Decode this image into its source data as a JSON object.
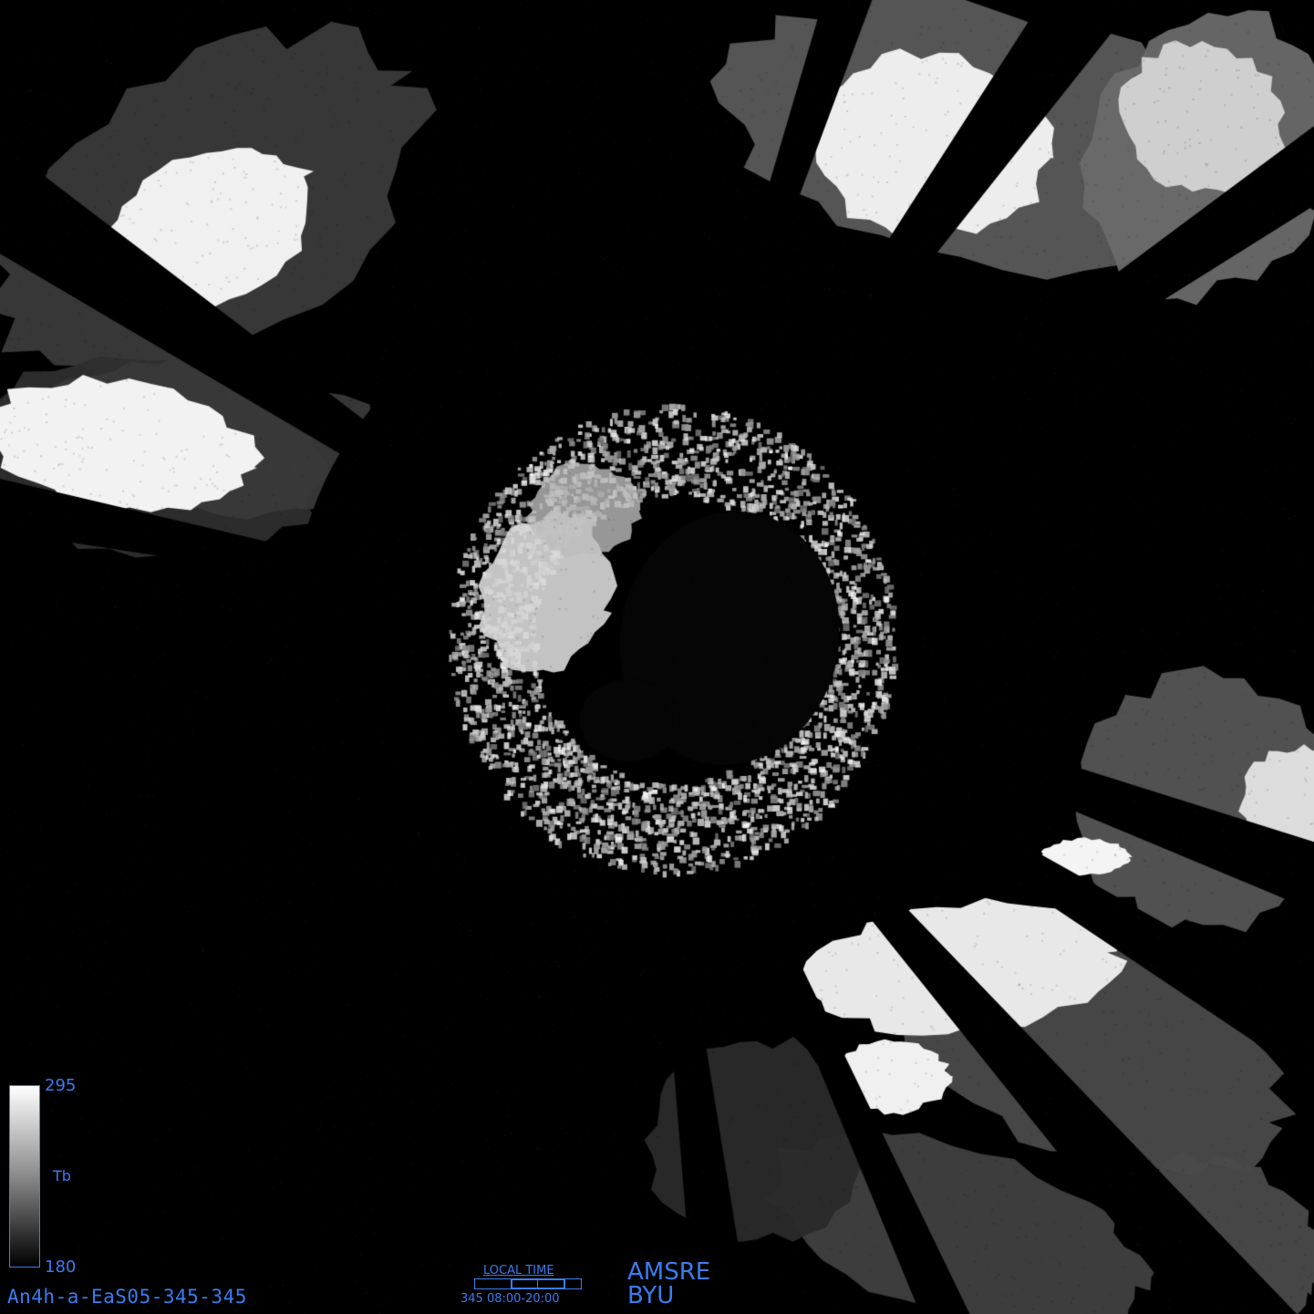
{
  "image": {
    "description_free": true,
    "background_color": "#000000",
    "overlay_color": "#3b7cf0"
  },
  "colorbar": {
    "max": "295",
    "min": "180",
    "label": "Tb"
  },
  "image_id": "An4h-a-EaS05-345-345",
  "local_time": {
    "title": "LOCAL TIME",
    "range": "345 08:00-20:00"
  },
  "sensor": "AMSRE",
  "org": "BYU"
}
